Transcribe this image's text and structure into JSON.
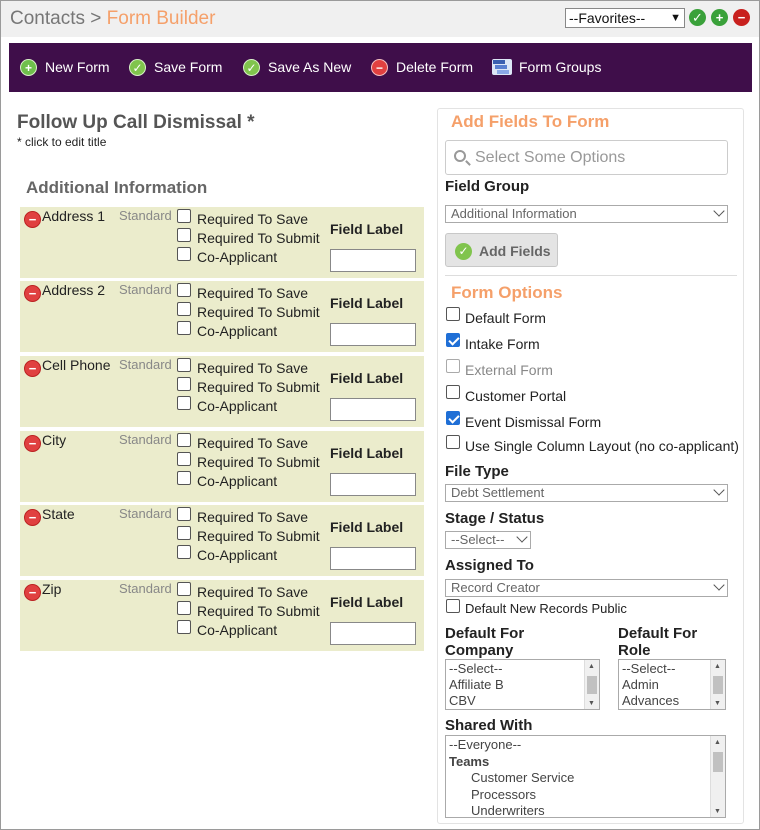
{
  "breadcrumb": {
    "parent": "Contacts",
    "separator": ">",
    "current": "Form Builder"
  },
  "favorites": {
    "selected": "--Favorites--"
  },
  "toolbar": {
    "new_form": "New Form",
    "save_form": "Save Form",
    "save_as_new": "Save As New",
    "delete_form": "Delete Form",
    "form_groups": "Form Groups"
  },
  "form": {
    "title": "Follow Up Call Dismissal *",
    "subtitle": "* click to edit title",
    "section_header": "Additional Information",
    "option_labels": {
      "required_save": "Required To Save",
      "required_submit": "Required To Submit",
      "co_applicant": "Co-Applicant"
    },
    "field_label_caption": "Field Label",
    "fields": [
      {
        "name": "Address 1",
        "type": "Standard",
        "label_value": ""
      },
      {
        "name": "Address 2",
        "type": "Standard",
        "label_value": ""
      },
      {
        "name": "Cell Phone",
        "type": "Standard",
        "label_value": ""
      },
      {
        "name": "City",
        "type": "Standard",
        "label_value": ""
      },
      {
        "name": "State",
        "type": "Standard",
        "label_value": ""
      },
      {
        "name": "Zip",
        "type": "Standard",
        "label_value": ""
      }
    ]
  },
  "panel": {
    "add_fields_header": "Add Fields To Form",
    "search_placeholder": "Select Some Options",
    "field_group_label": "Field Group",
    "field_group_value": "Additional Information",
    "add_fields_button": "Add Fields",
    "form_options_header": "Form Options",
    "options": [
      {
        "label": "Default Form",
        "checked": false,
        "disabled": false
      },
      {
        "label": "Intake Form",
        "checked": true,
        "disabled": false
      },
      {
        "label": "External Form",
        "checked": false,
        "disabled": true
      },
      {
        "label": "Customer Portal",
        "checked": false,
        "disabled": false
      },
      {
        "label": "Event Dismissal Form",
        "checked": true,
        "disabled": false
      },
      {
        "label": "Use Single Column Layout (no co-applicant)",
        "checked": false,
        "disabled": false
      }
    ],
    "file_type_label": "File Type",
    "file_type_value": "Debt Settlement",
    "stage_label": "Stage / Status",
    "stage_value": "--Select--",
    "assigned_label": "Assigned To",
    "assigned_value": "Record Creator",
    "default_public_label": "Default New Records Public",
    "default_company_label_1": "Default For",
    "default_company_label_2": "Company",
    "default_company_items": [
      "--Select--",
      "Affiliate B",
      "CBV"
    ],
    "default_role_label_1": "Default For",
    "default_role_label_2": "Role",
    "default_role_items": [
      "--Select--",
      "Admin",
      "Advances"
    ],
    "shared_with_label": "Shared With",
    "shared_with_items": [
      {
        "text": "--Everyone--",
        "bold": false,
        "indent": false
      },
      {
        "text": "Teams",
        "bold": true,
        "indent": false
      },
      {
        "text": "Customer Service",
        "bold": false,
        "indent": true
      },
      {
        "text": "Processors",
        "bold": false,
        "indent": true
      },
      {
        "text": "Underwriters",
        "bold": false,
        "indent": true
      }
    ]
  }
}
